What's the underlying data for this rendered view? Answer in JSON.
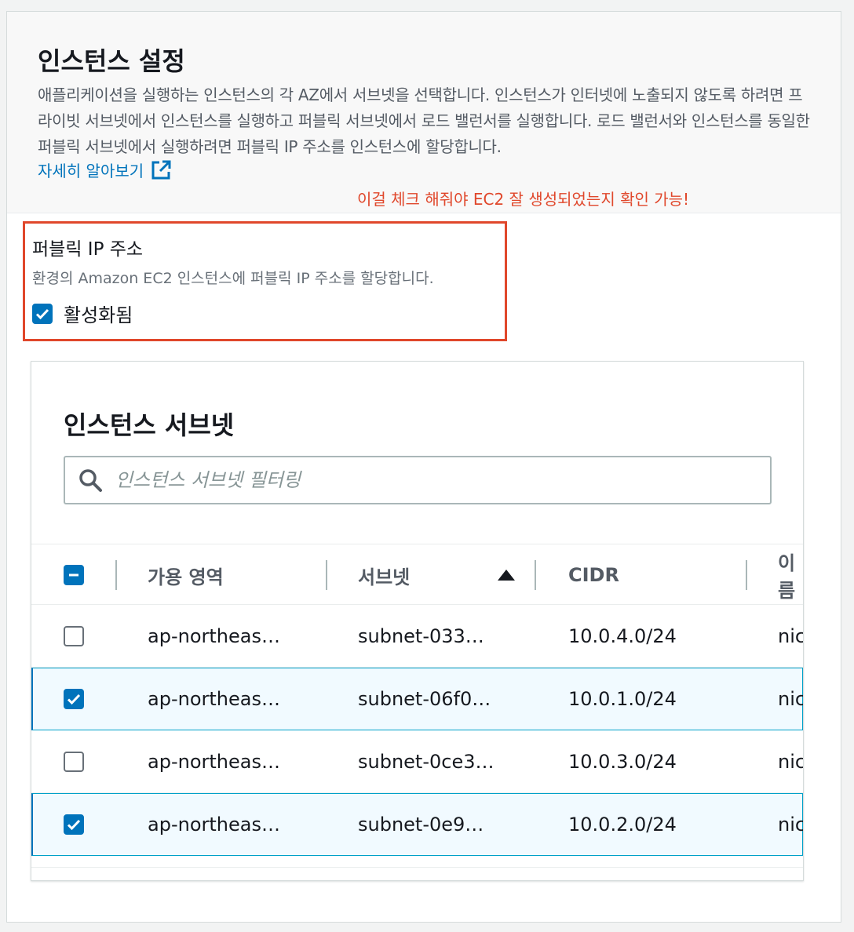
{
  "header": {
    "title": "인스턴스 설정",
    "description": "애플리케이션을 실행하는 인스턴스의 각 AZ에서 서브넷을 선택합니다. 인스턴스가 인터넷에 노출되지 않도록 하려면 프라이빗 서브넷에서 인스턴스를 실행하고 퍼블릭 서브넷에서 로드 밸런서를 실행합니다. 로드 밸런서와 인스턴스를 동일한 퍼블릭 서브넷에서 실행하려면 퍼블릭 IP 주소를 인스턴스에 할당합니다.",
    "learn_more": "자세히 알아보기",
    "learn_more_icon": "external-link-icon"
  },
  "annotation": "이걸 체크 해줘야 EC2 잘 생성되었는지 확인 가능!",
  "public_ip": {
    "label": "퍼블릭 IP 주소",
    "description": "환경의 Amazon EC2 인스턴스에 퍼블릭 IP 주소를 할당합니다.",
    "checkbox_label": "활성화됨",
    "checked": true
  },
  "subnets": {
    "title": "인스턴스 서브넷",
    "search_placeholder": "인스턴스 서브넷 필터링",
    "search_value": "",
    "columns": [
      "가용 영역",
      "서브넷",
      "CIDR",
      "이름"
    ],
    "sort_column": "서브넷",
    "sort_direction": "ascending",
    "rows": [
      {
        "az": "ap-northeas…",
        "subnet": "subnet-033…",
        "cidr": "10.0.4.0/24",
        "name": "nic",
        "selected": false
      },
      {
        "az": "ap-northeas…",
        "subnet": "subnet-06f0…",
        "cidr": "10.0.1.0/24",
        "name": "nic",
        "selected": true
      },
      {
        "az": "ap-northeas…",
        "subnet": "subnet-0ce3…",
        "cidr": "10.0.3.0/24",
        "name": "nic",
        "selected": false
      },
      {
        "az": "ap-northeas…",
        "subnet": "subnet-0e9…",
        "cidr": "10.0.2.0/24",
        "name": "nic",
        "selected": true
      }
    ]
  },
  "colors": {
    "accent": "#0073bb",
    "annotation": "#e0472b",
    "selected_row_bg": "#f1faff",
    "selected_row_border": "#00a1c9"
  }
}
